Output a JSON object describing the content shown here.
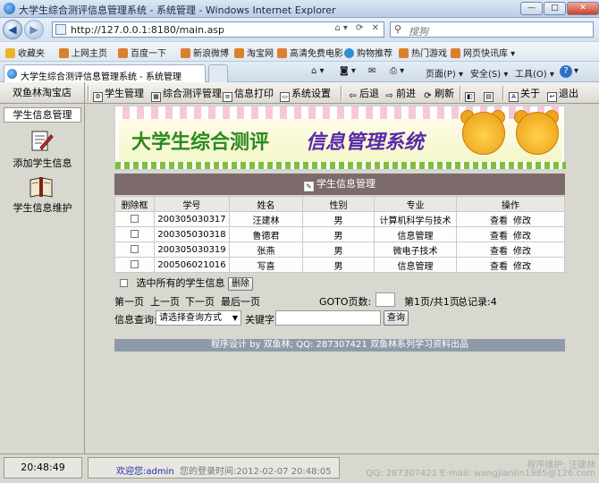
{
  "window": {
    "title": "大学生综合测评信息管理系统 - 系统管理 - Windows Internet Explorer",
    "minimize": "—",
    "maximize": "□",
    "close": "✕"
  },
  "addressbar": {
    "url": "http://127.0.0.1:8180/main.asp",
    "search_placeholder": "搜狗"
  },
  "favorites": {
    "label": "收藏夹",
    "items": [
      "上网主页",
      "百度一下",
      "新浪微博",
      "淘宝网",
      "高清免费电影",
      "购物推荐",
      "热门游戏",
      "网页快讯库"
    ]
  },
  "tab": {
    "title": "大学生综合测评信息管理系统 - 系统管理"
  },
  "commandbar": {
    "page": "页面(P)",
    "safety": "安全(S)",
    "tools": "工具(O)",
    "help": "?"
  },
  "app": {
    "shop_name": "双鱼林淘宝店",
    "toolbar": {
      "student_mgmt": "学生管理",
      "assessment_mgmt": "综合测评管理",
      "info_print": "信息打印",
      "system_settings": "系统设置",
      "back": "后退",
      "forward": "前进",
      "refresh": "刷新",
      "about": "关于",
      "exit": "退出"
    },
    "left_menu": {
      "header": "学生信息管理",
      "items": [
        {
          "label": "添加学生信息",
          "icon": "edit-document-icon"
        },
        {
          "label": "学生信息维护",
          "icon": "open-book-icon"
        }
      ]
    },
    "banner": {
      "part1": "大学生综合测评",
      "part2": "信息管理系统"
    },
    "section_title": "学生信息管理",
    "table": {
      "headers": [
        "删除框",
        "学号",
        "姓名",
        "性别",
        "专业",
        "操作"
      ],
      "rows": [
        {
          "id": "200305030317",
          "name": "汪建林",
          "gender": "男",
          "major": "计算机科学与技术"
        },
        {
          "id": "200305030318",
          "name": "鲁德君",
          "gender": "男",
          "major": "信息管理"
        },
        {
          "id": "200305030319",
          "name": "张燕",
          "gender": "男",
          "major": "微电子技术"
        },
        {
          "id": "200506021016",
          "name": "写喜",
          "gender": "男",
          "major": "信息管理"
        }
      ],
      "action_view": "查看",
      "action_edit": "修改"
    },
    "select_all_label": "选中所有的学生信息",
    "delete_button": "删除",
    "pager": {
      "first": "第一页",
      "prev": "上一页",
      "next": "下一页",
      "last": "最后一页",
      "goto_label": "GOTO页数:",
      "page_info": "第1页/共1页",
      "record_count": "总记录:4"
    },
    "query": {
      "label": "信息查询:",
      "select_value": "请选择查询方式",
      "keyword_label": "关键字:",
      "button": "查询"
    },
    "footer_text": "程序设计 by 双鱼林; QQ: 287307421 双鱼林系列学习资料出品",
    "status": {
      "time": "20:48:49",
      "welcome": "欢迎您:admin",
      "last_login": "您的登录时间:2012-02-07 20:48:05",
      "maintainer": "程序维护: 汪建林",
      "contact": "QQ: 287307421 E-mail: wangjianlin1985@126.com"
    }
  }
}
